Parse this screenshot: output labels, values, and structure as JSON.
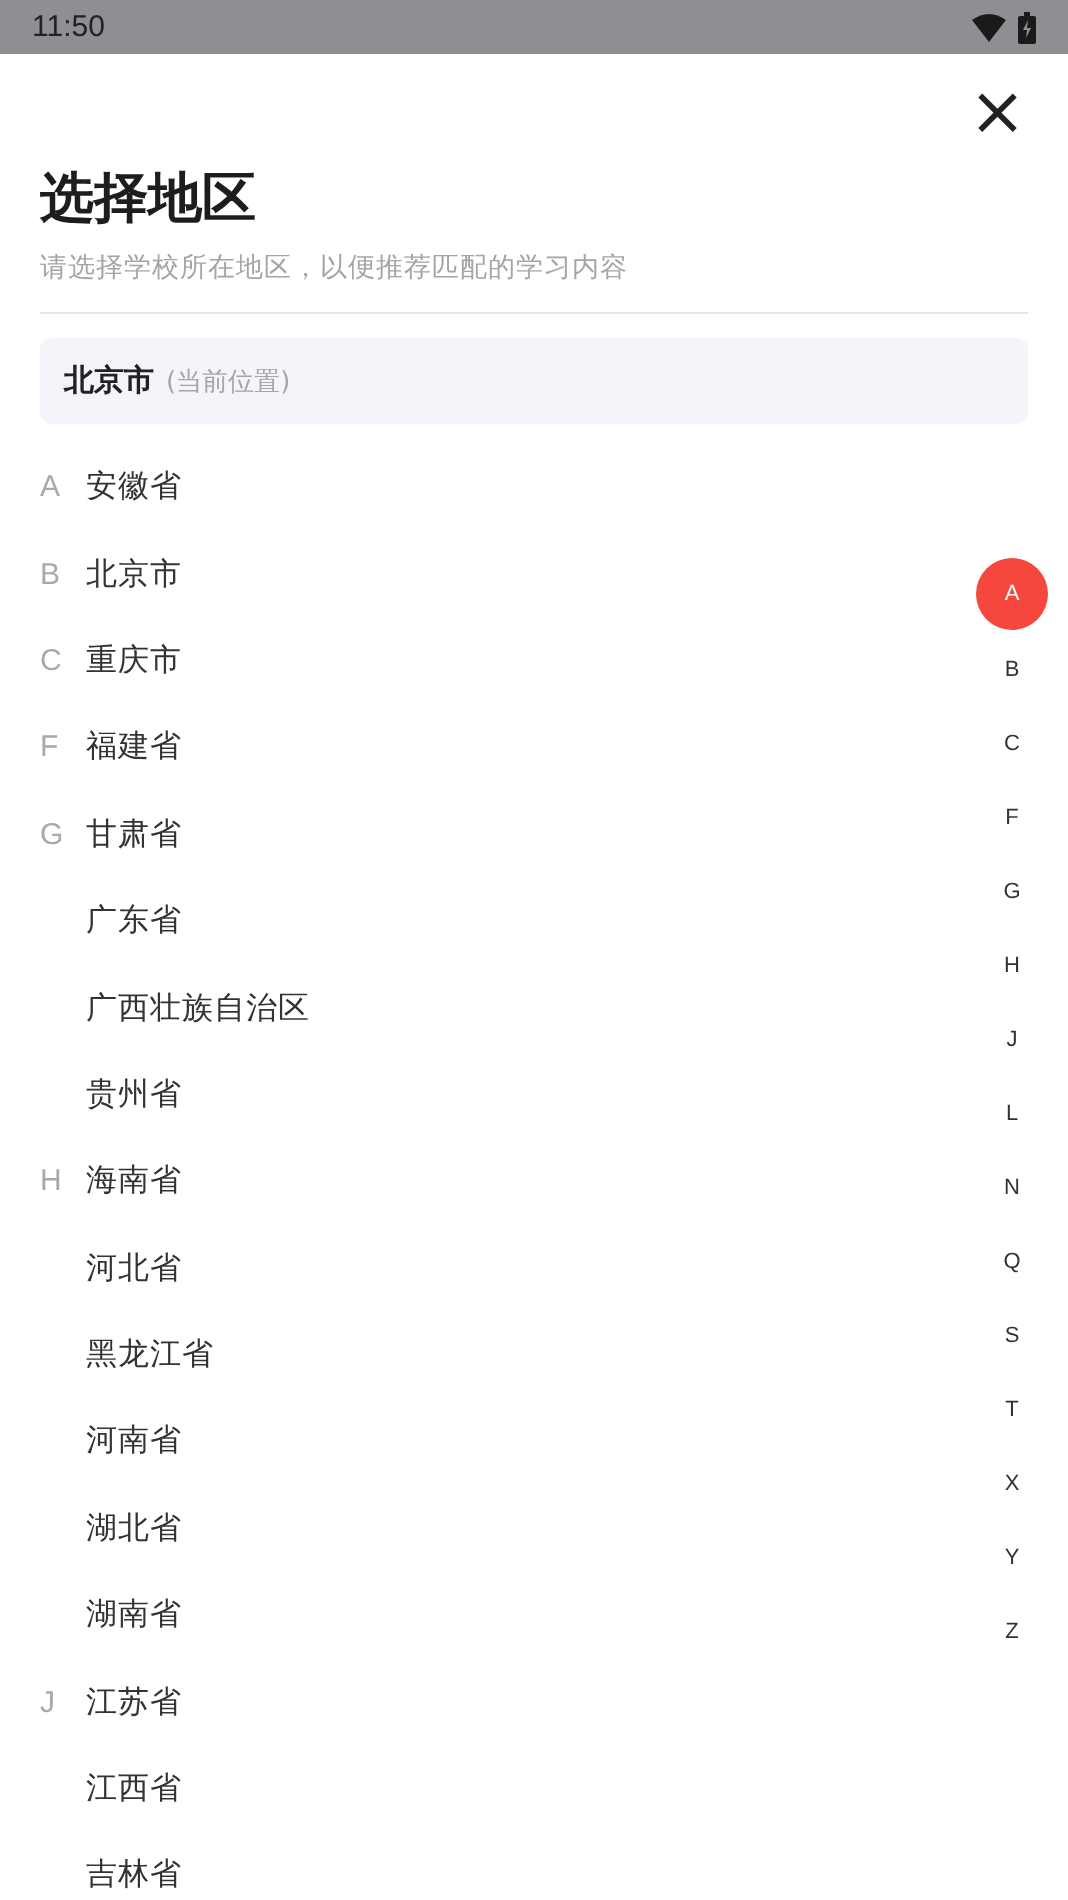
{
  "status_bar": {
    "time": "11:50"
  },
  "sheet": {
    "close": "×",
    "title": "选择地区",
    "subtitle": "请选择学校所在地区，以便推荐匹配的学习内容"
  },
  "current_location": {
    "name": "北京市",
    "note": "(当前位置)"
  },
  "regions": [
    {
      "letter": "A",
      "name": "安徽省"
    },
    {
      "letter": "B",
      "name": "北京市"
    },
    {
      "letter": "C",
      "name": "重庆市"
    },
    {
      "letter": "F",
      "name": "福建省"
    },
    {
      "letter": "G",
      "name": "甘肃省"
    },
    {
      "name": "广东省"
    },
    {
      "name": "广西壮族自治区"
    },
    {
      "name": "贵州省"
    },
    {
      "letter": "H",
      "name": "海南省"
    },
    {
      "name": "河北省"
    },
    {
      "name": "黑龙江省"
    },
    {
      "name": "河南省"
    },
    {
      "name": "湖北省"
    },
    {
      "name": "湖南省"
    },
    {
      "letter": "J",
      "name": "江苏省"
    },
    {
      "name": "江西省"
    },
    {
      "name": "吉林省"
    }
  ],
  "index_bar": [
    {
      "label": "A",
      "selected": true
    },
    {
      "label": "B",
      "selected": false
    },
    {
      "label": "C",
      "selected": false
    },
    {
      "label": "F",
      "selected": false
    },
    {
      "label": "G",
      "selected": false
    },
    {
      "label": "H",
      "selected": false
    },
    {
      "label": "J",
      "selected": false
    },
    {
      "label": "L",
      "selected": false
    },
    {
      "label": "N",
      "selected": false
    },
    {
      "label": "Q",
      "selected": false
    },
    {
      "label": "S",
      "selected": false
    },
    {
      "label": "T",
      "selected": false
    },
    {
      "label": "X",
      "selected": false
    },
    {
      "label": "Y",
      "selected": false
    },
    {
      "label": "Z",
      "selected": false
    }
  ]
}
